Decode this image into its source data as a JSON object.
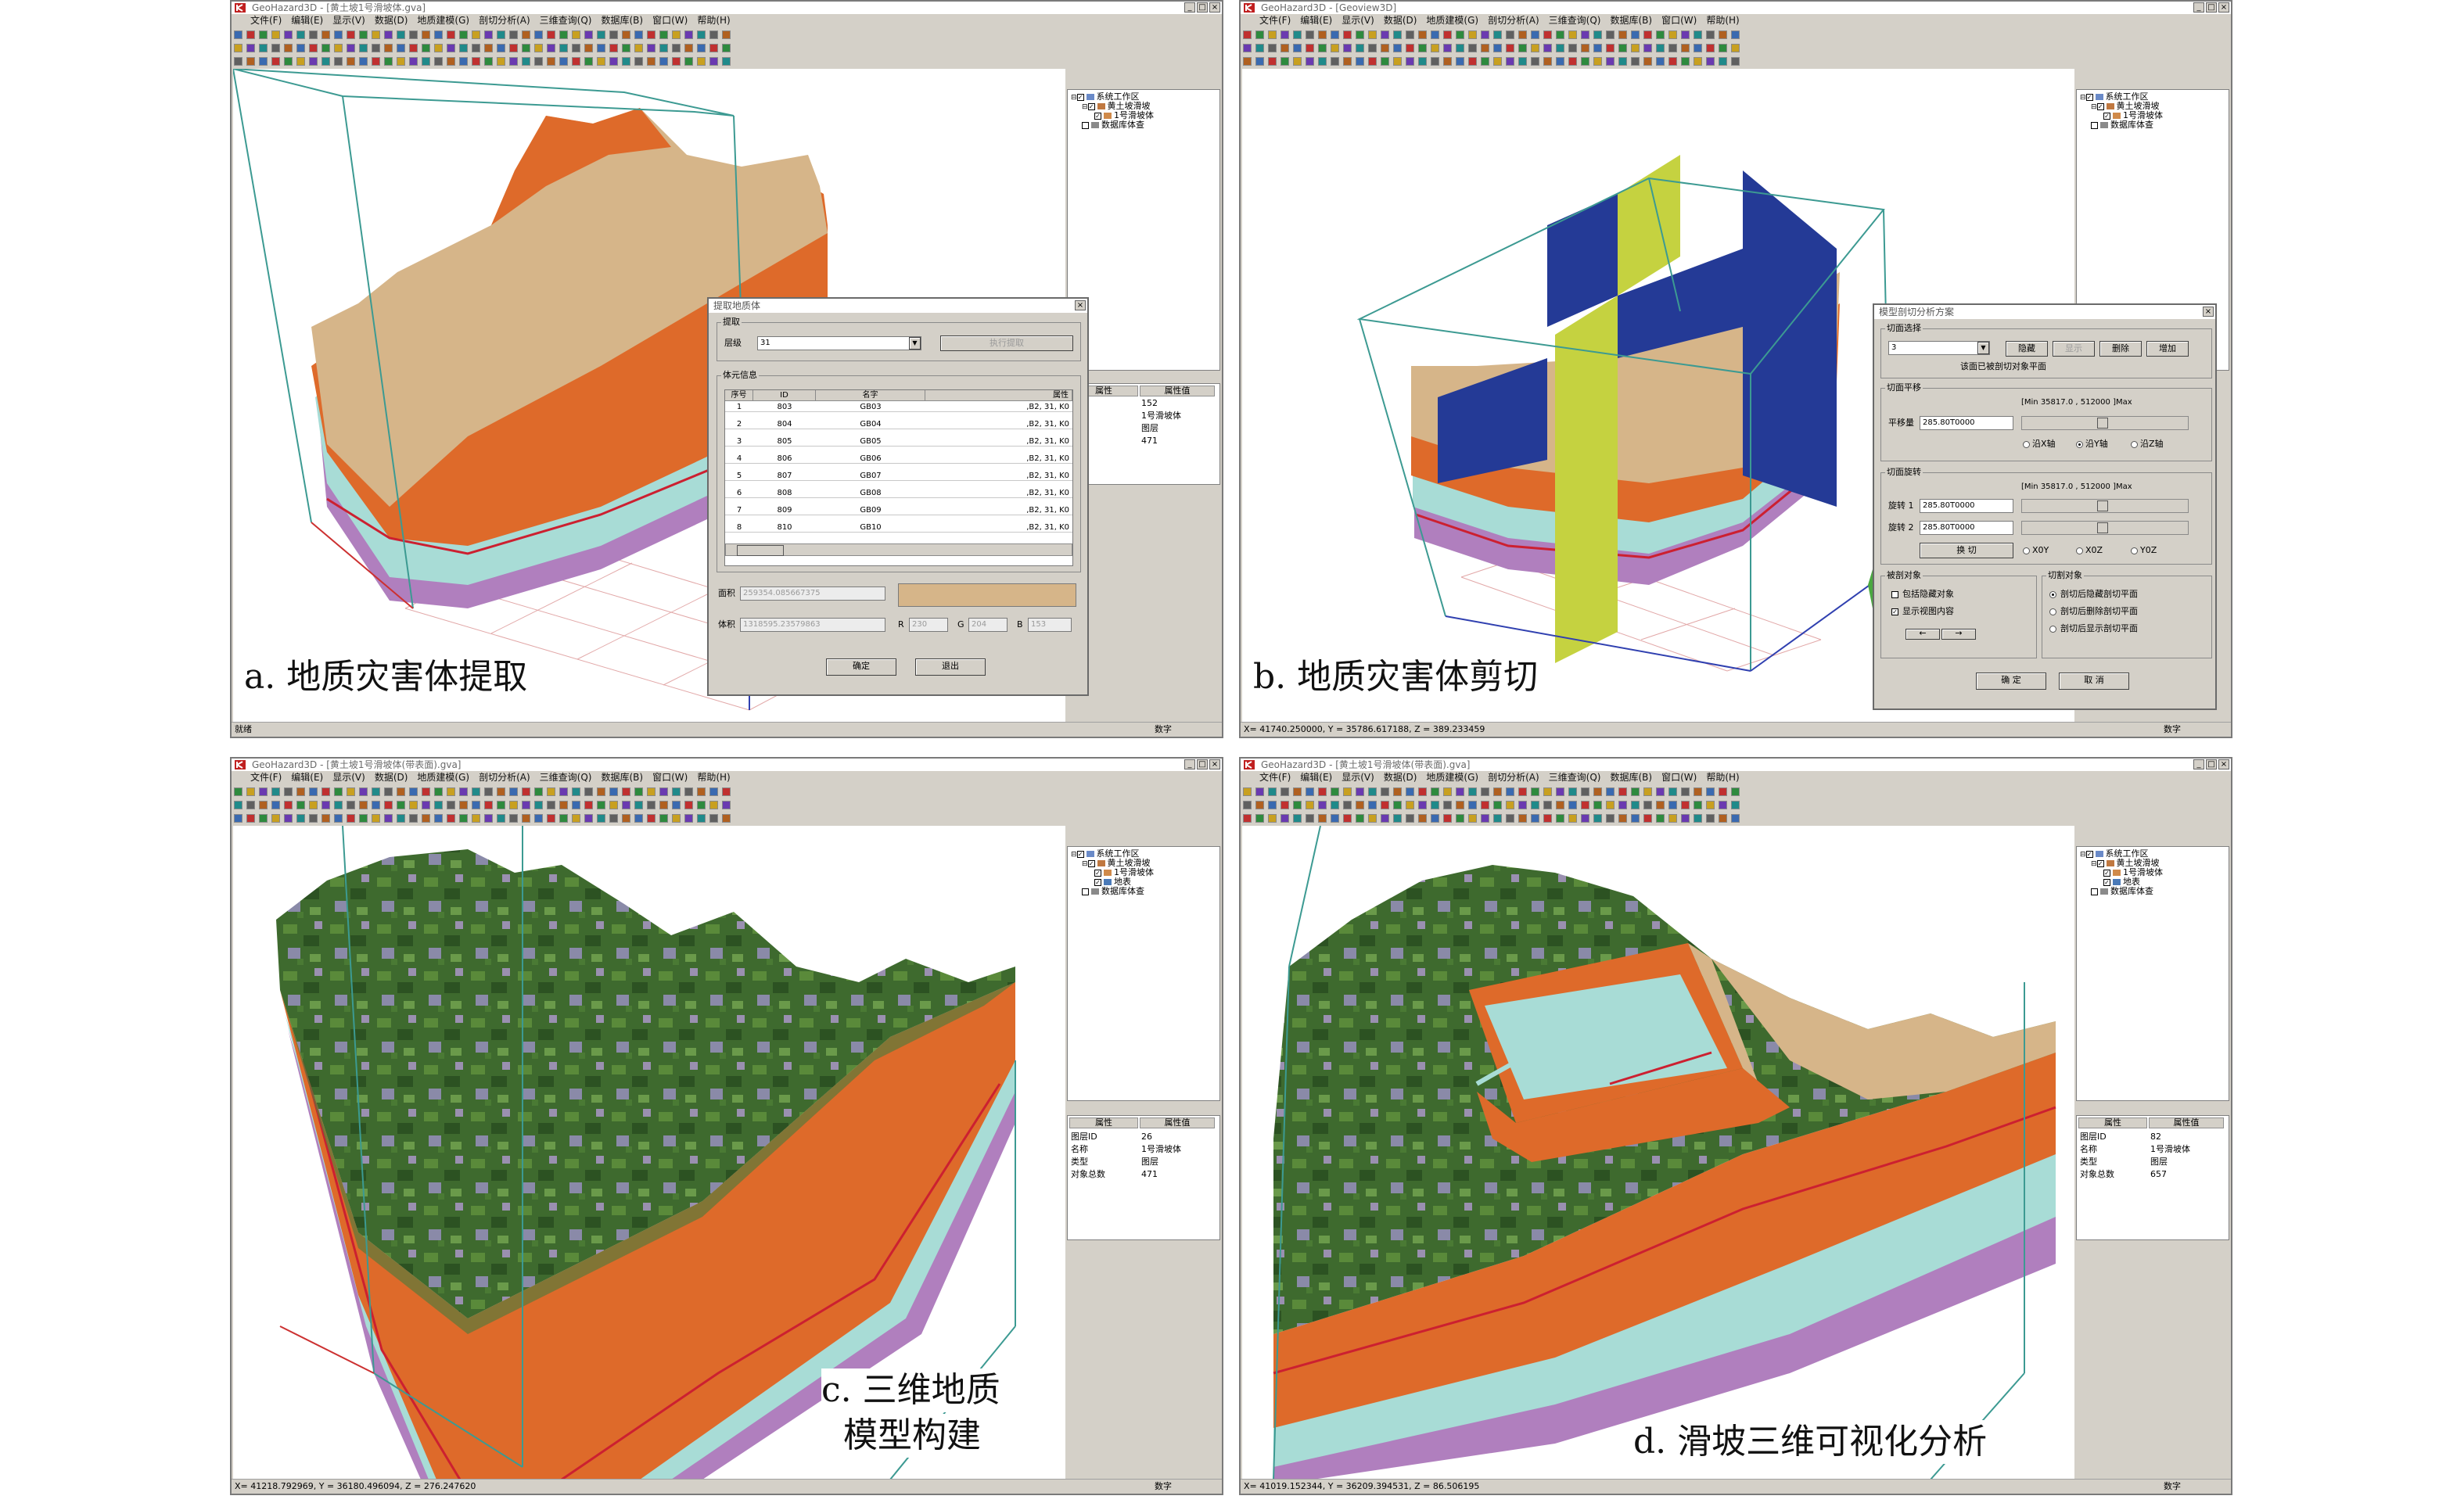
{
  "colors": {
    "orange": "#de6a2a",
    "tan": "#d6b589",
    "cyan": "#a8dcd6",
    "purple": "#b07fbe",
    "red": "#cc2030",
    "blue": "#243a96",
    "yellow": "#c5d240",
    "frame": "#3c9a92"
  },
  "menu": [
    "文件(F)",
    "编辑(E)",
    "显示(V)",
    "数据(D)",
    "地质建模(G)",
    "剖切分析(A)",
    "三维查询(Q)",
    "数据库(B)",
    "窗口(W)",
    "帮助(H)"
  ],
  "panel_a": {
    "title": "GeoHazard3D - [黄土坡1号滑坡体.gva]",
    "caption": "a. 地质灾害体提取",
    "tree": [
      {
        "label": "系统工作区",
        "checked": true
      },
      {
        "label": "黄土坡滑坡",
        "checked": true
      },
      {
        "label": "1号滑坡体",
        "checked": true
      },
      {
        "label": "数据库体查",
        "checked": false
      }
    ],
    "attr_header": [
      "属性",
      "属性值"
    ],
    "attr_rows": [
      [
        "ID",
        "152"
      ],
      [
        "",
        "1号滑坡体"
      ],
      [
        "",
        "图层"
      ],
      [
        "总数",
        "471"
      ]
    ],
    "status": "就绪",
    "status_num": "数字",
    "dialog": {
      "title": "提取地质体",
      "group1": "提取",
      "field_label": "层级",
      "field_value": "31",
      "extract_btn": "执行提取",
      "group2": "体元信息",
      "columns": [
        "序号",
        "ID",
        "名字",
        "属性"
      ],
      "rows": [
        [
          "1",
          "803",
          "GB03",
          ",B2, 31, K0"
        ],
        [
          "2",
          "804",
          "GB04",
          ",B2, 31, K0"
        ],
        [
          "3",
          "805",
          "GB05",
          ",B2, 31, K0"
        ],
        [
          "4",
          "806",
          "GB06",
          ",B2, 31, K0"
        ],
        [
          "5",
          "807",
          "GB07",
          ",B2, 31, K0"
        ],
        [
          "6",
          "808",
          "GB08",
          ",B2, 31, K0"
        ],
        [
          "7",
          "809",
          "GB09",
          ",B2, 31, K0"
        ],
        [
          "8",
          "810",
          "GB10",
          ",B2, 31, K0"
        ]
      ],
      "area_label": "面积",
      "area_value": "259354.085667375",
      "volume_label": "体积",
      "volume_value": "1318595.23579863",
      "r_label": "R",
      "r_value": "230",
      "g_label": "G",
      "g_value": "204",
      "b_label": "B",
      "b_value": "153",
      "ok": "确定",
      "cancel": "退出"
    }
  },
  "panel_b": {
    "title": "GeoHazard3D - [Geoview3D]",
    "caption": "b. 地质灾害体剪切",
    "tree": [
      {
        "label": "系统工作区",
        "checked": true
      },
      {
        "label": "黄土坡滑坡",
        "checked": true
      },
      {
        "label": "1号滑坡体",
        "checked": true
      },
      {
        "label": "数据库体查",
        "checked": false
      }
    ],
    "status": "X= 41740.250000, Y = 35786.617188, Z = 389.233459",
    "status_num": "数字",
    "dialog": {
      "title": "模型剖切分析方案",
      "group1": "切面选择",
      "select_value": "3",
      "btn_hide": "隐藏",
      "btn_show": "显示",
      "btn_delete": "删除",
      "btn_add": "增加",
      "hint": "该面已被剖切对象平面",
      "group2": "切面平移",
      "range_text": "[Min 35817.0  ,  512000 ]Max",
      "shift_label": "平移量",
      "shift_value": "285.80T0000",
      "radio_x": "沿X轴",
      "radio_y": "沿Y轴",
      "radio_z": "沿Z轴",
      "group3": "切面旋转",
      "rot1_label": "旋转 1",
      "rot1_value": "285.80T0000",
      "rot2_label": "旋转 2",
      "rot2_value": "285.80T0000",
      "switch_btn": "换 切",
      "ax1": "X0Y",
      "ax2": "X0Z",
      "ax3": "Y0Z",
      "group4": "被剖对象",
      "chk1": "包括隐藏对象",
      "chk2": "显示视图内容",
      "group5": "切割对象",
      "opt1": "剖切后隐藏剖切平面",
      "opt2": "剖切后删除剖切平面",
      "opt3": "剖切后显示剖切平面",
      "ok": "确 定",
      "cancel": "取 消"
    }
  },
  "panel_c": {
    "title": "GeoHazard3D - [黄土坡1号滑坡体(带表面).gva]",
    "caption_line1": "c. 三维地质",
    "caption_line2": "模型构建",
    "tree": [
      {
        "label": "系统工作区",
        "checked": true
      },
      {
        "label": "黄土坡滑坡",
        "checked": true
      },
      {
        "label": "1号滑坡体",
        "checked": true
      },
      {
        "label": "地表",
        "checked": true
      },
      {
        "label": "数据库体查",
        "checked": false
      }
    ],
    "attr_header": [
      "属性",
      "属性值"
    ],
    "attr_rows": [
      [
        "图层ID",
        "26"
      ],
      [
        "名称",
        "1号滑坡体"
      ],
      [
        "类型",
        "图层"
      ],
      [
        "对象总数",
        "471"
      ]
    ],
    "status": "X= 41218.792969, Y = 36180.496094, Z = 276.247620",
    "status_num": "数字"
  },
  "panel_d": {
    "title": "GeoHazard3D - [黄土坡1号滑坡体(带表面).gva]",
    "caption": "d. 滑坡三维可视化分析",
    "tree": [
      {
        "label": "系统工作区",
        "checked": true
      },
      {
        "label": "黄土坡滑坡",
        "checked": true
      },
      {
        "label": "1号滑坡体",
        "checked": true
      },
      {
        "label": "地表",
        "checked": true
      },
      {
        "label": "数据库体查",
        "checked": false
      }
    ],
    "attr_header": [
      "属性",
      "属性值"
    ],
    "attr_rows": [
      [
        "图层ID",
        "82"
      ],
      [
        "名称",
        "1号滑坡体"
      ],
      [
        "类型",
        "图层"
      ],
      [
        "对象总数",
        "657"
      ]
    ],
    "status": "X= 41019.152344, Y = 36209.394531, Z = 86.506195",
    "status_num": "数字"
  }
}
